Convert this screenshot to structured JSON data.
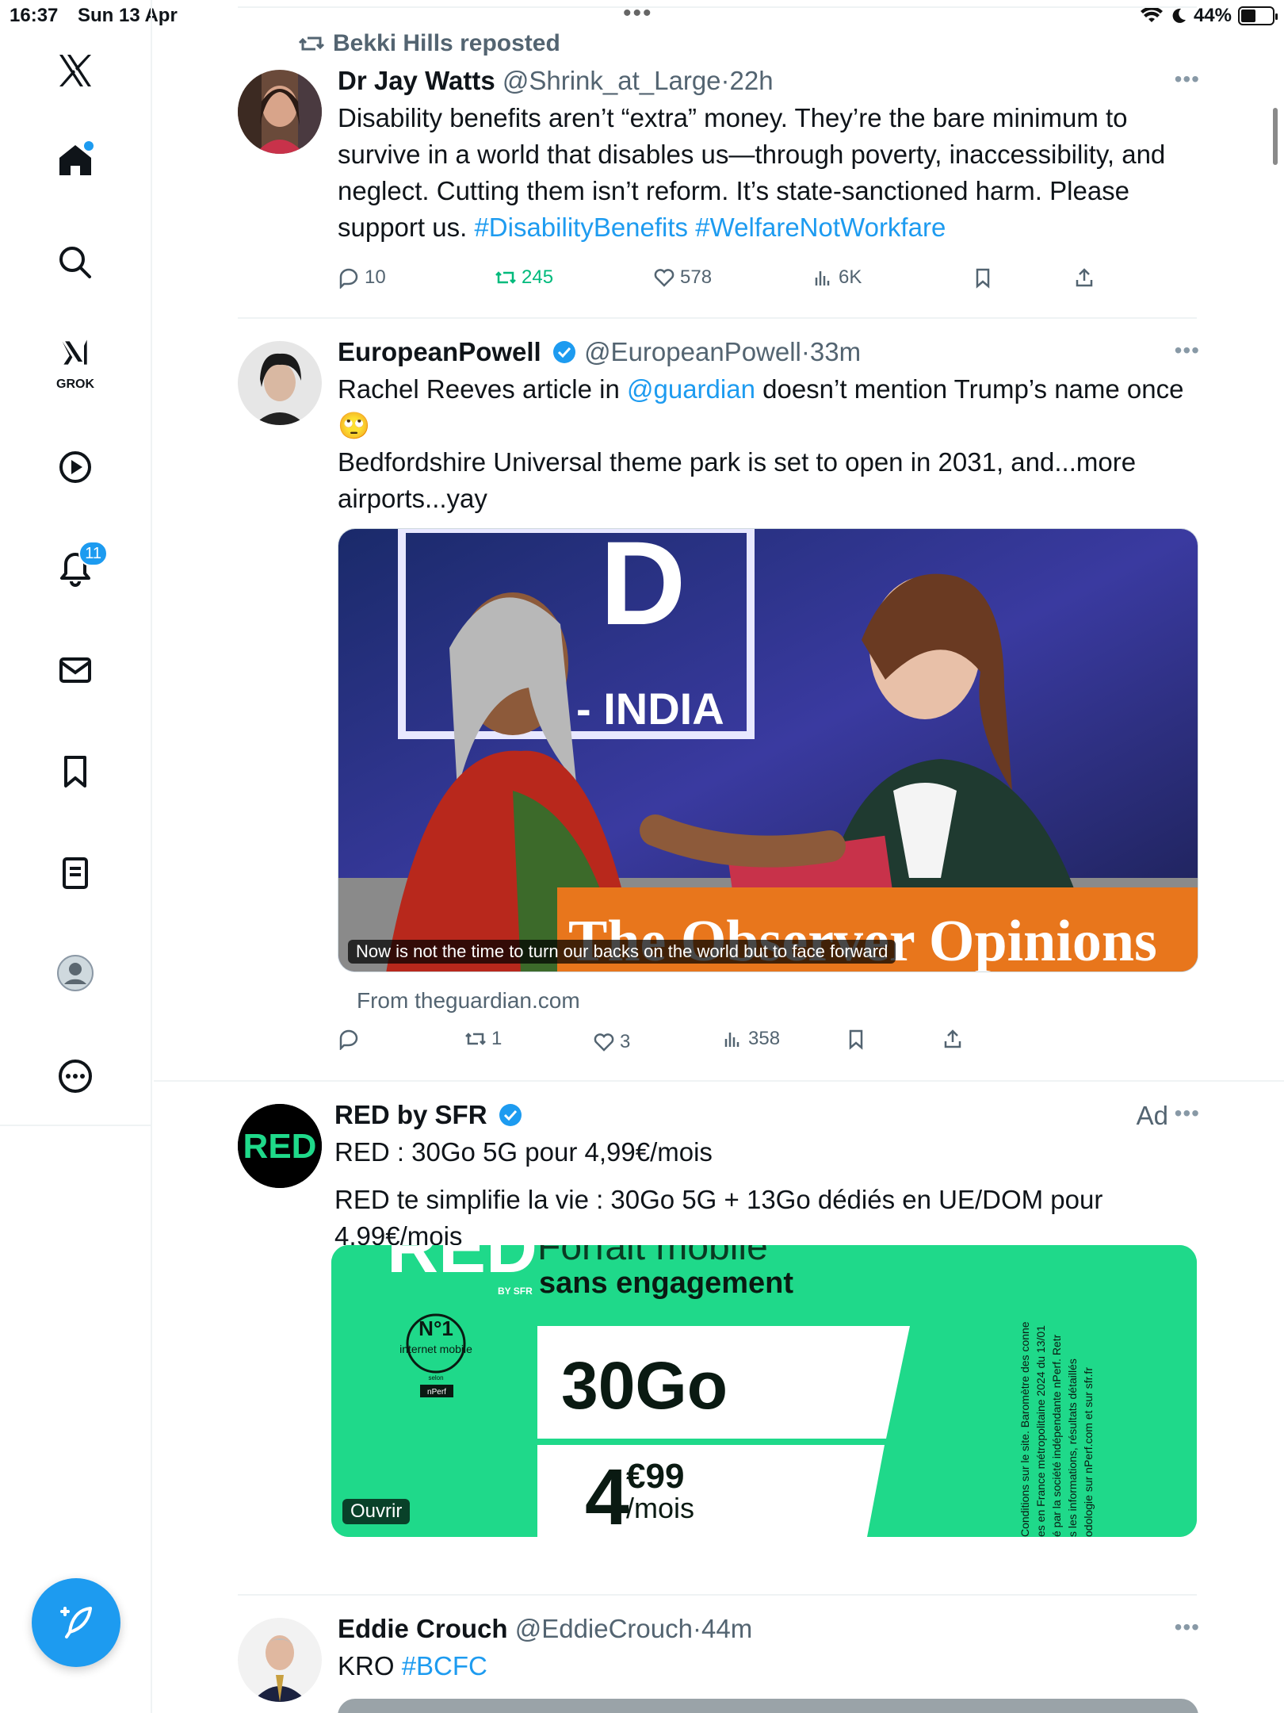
{
  "status_bar": {
    "time": "16:37",
    "date": "Sun 13 Apr",
    "battery": "44%"
  },
  "sidebar": {
    "grok_label": "GROK",
    "notifications_badge": "11"
  },
  "tweets": [
    {
      "repost_label": "Bekki Hills reposted",
      "name": "Dr Jay Watts",
      "handle": "@Shrink_at_Large",
      "time": "22h",
      "text_parts": [
        "Disability benefits aren’t “extra” money. They’re the bare minimum to survive in a world that disables us—through poverty, inaccessibility, and neglect. Cutting them isn’t reform. It’s state-sanctioned harm. Please support us. "
      ],
      "hashtags": [
        "#DisabilityBenefits",
        "#WelfareNotWorkfare"
      ],
      "replies": "10",
      "reposts": "245",
      "likes": "578",
      "views": "6K"
    },
    {
      "name": "EuropeanPowell",
      "handle": "@EuropeanPowell",
      "time": "33m",
      "text_before_link": "Rachel Reeves article in ",
      "link": "@guardian",
      "text_after_link": " doesn’t mention Trump’s name once🙄",
      "text_line2": "Bedfordshire Universal theme park  is set to open in 2031, and...more airports...yay",
      "media_caption": "Now is not the time to turn our backs on the world but to face forward",
      "media_banner": "The Observer Opinions",
      "media_backdrop_text": "- INDIA",
      "media_backdrop_letter": "D",
      "from_line": "From theguardian.com",
      "replies": "",
      "reposts": "1",
      "likes": "3",
      "views": "358"
    },
    {
      "name": "RED by SFR",
      "ad_label": "Ad",
      "avatar_text": "RED",
      "title": "RED : 30Go 5G pour 4,99€/mois",
      "text": "RED te simplifie la vie : 30Go 5G + 13Go dédiés en UE/DOM pour 4,99€/mois",
      "ad": {
        "logo": "RED",
        "logo_sub": "BY SFR",
        "headline_top": "Forfait mobile",
        "headline": "sans engagement",
        "badge_top": "N°1",
        "badge_mid": "internet mobile",
        "badge_small": "selon",
        "badge_brand": "nPerf",
        "data": "30Go",
        "price_big": "4",
        "price_cents": "€99",
        "price_unit": "/mois",
        "cta": "Ouvrir",
        "legal": [
          "Conditions sur le site. Baromètre des conne",
          "es en France métropolitaine 2024 du 13/01",
          "é par la société indépendante nPerf. Retr",
          "s les informations, résultats détaillés",
          "odologie sur nPerf.com et sur sfr.fr"
        ]
      }
    },
    {
      "name": "Eddie Crouch",
      "handle": "@EddieCrouch",
      "time": "44m",
      "text": "KRO ",
      "hashtag": "#BCFC"
    }
  ],
  "colors": {
    "accent": "#1d9bf0",
    "repost_green": "#00ba7c",
    "ad_green": "#1fd98a",
    "observer_orange": "#e8761c"
  }
}
